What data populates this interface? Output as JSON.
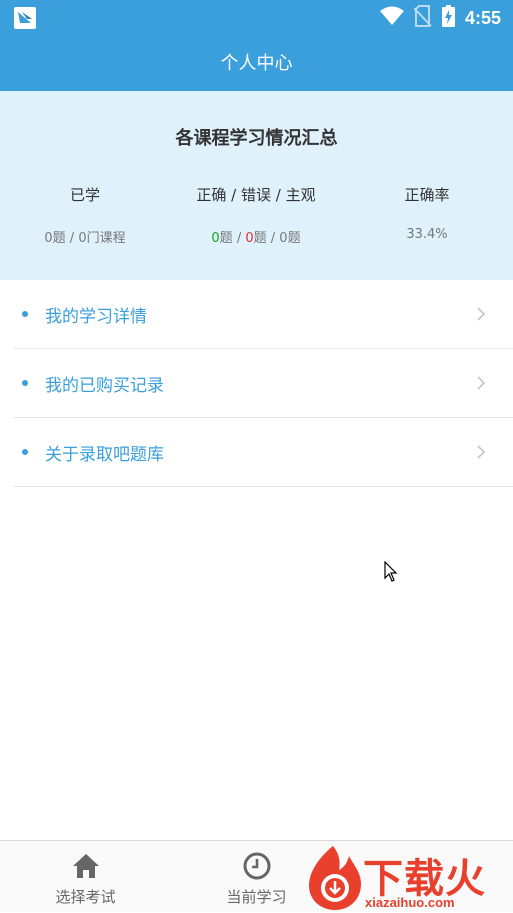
{
  "status_bar": {
    "time": "4:55",
    "icons": [
      "app-logo-icon",
      "wifi-icon",
      "no-sim-icon",
      "battery-charging-icon"
    ]
  },
  "header": {
    "title": "个人中心"
  },
  "summary": {
    "title": "各课程学习情况汇总",
    "columns": [
      {
        "head": "已学",
        "value": "0题 / 0门课程"
      },
      {
        "head": "正确 / 错误 / 主观",
        "correct": "0",
        "wrong": "0",
        "subjective": "0",
        "unit": "题",
        "sep": " / "
      },
      {
        "head": "正确率",
        "value": "33.4%"
      }
    ]
  },
  "menu": {
    "items": [
      {
        "label": "我的学习详情"
      },
      {
        "label": "我的已购买记录"
      },
      {
        "label": "关于录取吧题库"
      }
    ]
  },
  "bottom_nav": {
    "tabs": [
      {
        "label": "选择考试",
        "icon": "home-icon"
      },
      {
        "label": "当前学习",
        "icon": "clock-icon"
      }
    ]
  },
  "watermark": {
    "text": "下载火",
    "url": "xiazaihuo.com"
  },
  "colors": {
    "primary": "#3a9fdb",
    "summary_bg": "#dff1fb",
    "correct": "#1aa31a",
    "wrong": "#e03030",
    "watermark": "#e8402c"
  }
}
